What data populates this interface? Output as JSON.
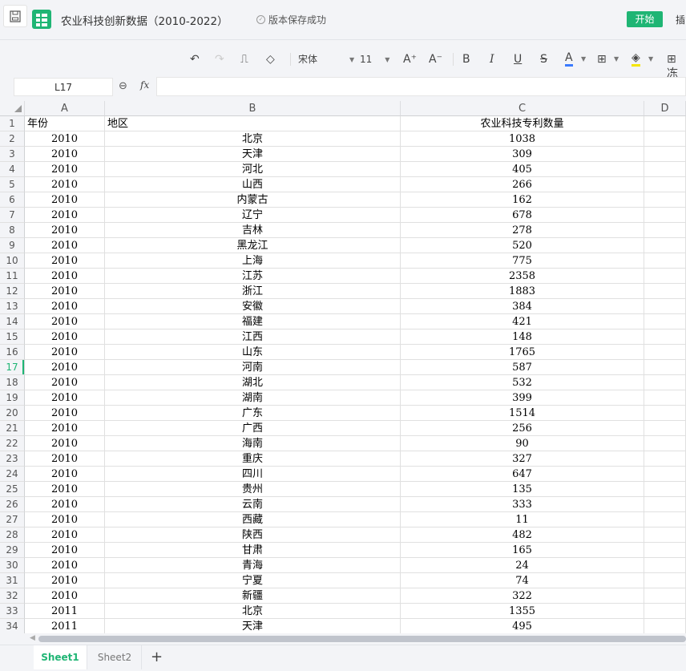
{
  "header": {
    "title": "农业科技创新数据（2010-2022）",
    "save_status": "版本保存成功",
    "start_tab": "开始",
    "insert_tab": "插"
  },
  "toolbar": {
    "font": "宋体",
    "size": "11",
    "bold": "B",
    "italic": "I",
    "underline": "U",
    "strike": "S",
    "font_color": "A",
    "font_color_hex": "#3a7afe",
    "fill_color_hex": "#f5e600",
    "grow": "A⁺",
    "shrink": "A⁻",
    "freeze": "冻"
  },
  "formula": {
    "cell_ref": "L17",
    "fx": "fx",
    "value": ""
  },
  "columns": [
    "A",
    "B",
    "C",
    "D"
  ],
  "selected_row": 17,
  "rows": [
    [
      "年份",
      "地区",
      "农业科技专利数量"
    ],
    [
      "2010",
      "北京",
      "1038"
    ],
    [
      "2010",
      "天津",
      "309"
    ],
    [
      "2010",
      "河北",
      "405"
    ],
    [
      "2010",
      "山西",
      "266"
    ],
    [
      "2010",
      "内蒙古",
      "162"
    ],
    [
      "2010",
      "辽宁",
      "678"
    ],
    [
      "2010",
      "吉林",
      "278"
    ],
    [
      "2010",
      "黑龙江",
      "520"
    ],
    [
      "2010",
      "上海",
      "775"
    ],
    [
      "2010",
      "江苏",
      "2358"
    ],
    [
      "2010",
      "浙江",
      "1883"
    ],
    [
      "2010",
      "安徽",
      "384"
    ],
    [
      "2010",
      "福建",
      "421"
    ],
    [
      "2010",
      "江西",
      "148"
    ],
    [
      "2010",
      "山东",
      "1765"
    ],
    [
      "2010",
      "河南",
      "587"
    ],
    [
      "2010",
      "湖北",
      "532"
    ],
    [
      "2010",
      "湖南",
      "399"
    ],
    [
      "2010",
      "广东",
      "1514"
    ],
    [
      "2010",
      "广西",
      "256"
    ],
    [
      "2010",
      "海南",
      "90"
    ],
    [
      "2010",
      "重庆",
      "327"
    ],
    [
      "2010",
      "四川",
      "647"
    ],
    [
      "2010",
      "贵州",
      "135"
    ],
    [
      "2010",
      "云南",
      "333"
    ],
    [
      "2010",
      "西藏",
      "11"
    ],
    [
      "2010",
      "陕西",
      "482"
    ],
    [
      "2010",
      "甘肃",
      "165"
    ],
    [
      "2010",
      "青海",
      "24"
    ],
    [
      "2010",
      "宁夏",
      "74"
    ],
    [
      "2010",
      "新疆",
      "322"
    ],
    [
      "2011",
      "北京",
      "1355"
    ],
    [
      "2011",
      "天津",
      "495"
    ]
  ],
  "sheets": [
    "Sheet1",
    "Sheet2"
  ],
  "add_sheet": "+"
}
